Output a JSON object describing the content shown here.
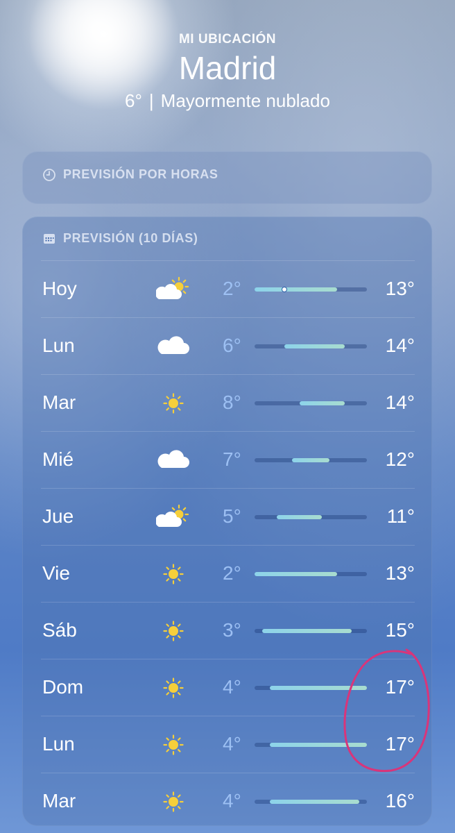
{
  "header": {
    "location_label": "MI UBICACIÓN",
    "city": "Madrid",
    "current_temp": "6°",
    "separator": "|",
    "condition": "Mayormente nublado"
  },
  "hourly": {
    "title": "PREVISIÓN POR HORAS",
    "icon": "clock-icon"
  },
  "daily": {
    "title": "PREVISIÓN (10 DÍAS)",
    "icon": "calendar-icon",
    "range_min": 2,
    "range_max": 17,
    "days": [
      {
        "day": "Hoy",
        "icon": "partly-cloudy-icon",
        "low": "2°",
        "high": "13°",
        "low_value": 2,
        "high_value": 13,
        "current": 6
      },
      {
        "day": "Lun",
        "icon": "cloud-icon",
        "low": "6°",
        "high": "14°",
        "low_value": 6,
        "high_value": 14
      },
      {
        "day": "Mar",
        "icon": "sun-icon",
        "low": "8°",
        "high": "14°",
        "low_value": 8,
        "high_value": 14
      },
      {
        "day": "Mié",
        "icon": "cloud-icon",
        "low": "7°",
        "high": "12°",
        "low_value": 7,
        "high_value": 12
      },
      {
        "day": "Jue",
        "icon": "partly-cloudy-icon",
        "low": "5°",
        "high": "11°",
        "low_value": 5,
        "high_value": 11
      },
      {
        "day": "Vie",
        "icon": "sun-icon",
        "low": "2°",
        "high": "13°",
        "low_value": 2,
        "high_value": 13
      },
      {
        "day": "Sáb",
        "icon": "sun-icon",
        "low": "3°",
        "high": "15°",
        "low_value": 3,
        "high_value": 15
      },
      {
        "day": "Dom",
        "icon": "sun-icon",
        "low": "4°",
        "high": "17°",
        "low_value": 4,
        "high_value": 17
      },
      {
        "day": "Lun",
        "icon": "sun-icon",
        "low": "4°",
        "high": "17°",
        "low_value": 4,
        "high_value": 17
      },
      {
        "day": "Mar",
        "icon": "sun-icon",
        "low": "4°",
        "high": "16°",
        "low_value": 4,
        "high_value": 16
      }
    ]
  },
  "colors": {
    "low_temp": "#a0c3f5",
    "bar_start": "#8dd3ea",
    "bar_end": "#a8dccf",
    "annotation": "#d9357a"
  }
}
